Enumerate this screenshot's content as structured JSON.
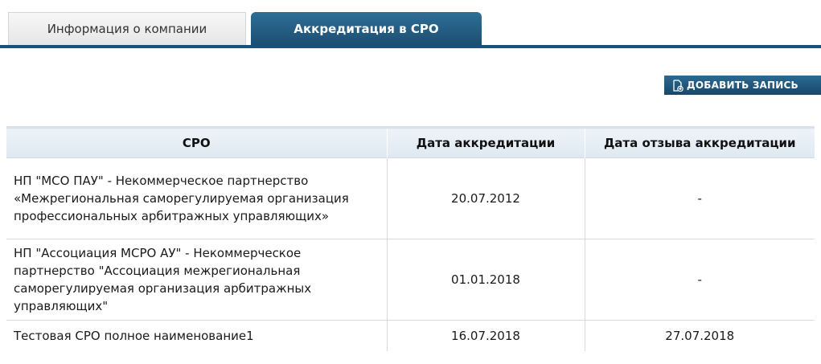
{
  "tabs": [
    {
      "label": "Информация о компании",
      "active": false
    },
    {
      "label": "Аккредитация в СРО",
      "active": true
    }
  ],
  "toolbar": {
    "add_label": "ДОБАВИТЬ ЗАПИСЬ",
    "add_icon": "add-document-icon"
  },
  "table": {
    "columns": [
      "СРО",
      "Дата аккредитации",
      "Дата отзыва аккредитации"
    ],
    "rows": [
      {
        "sro": "НП \"МСО ПАУ\" - Некоммерческое партнерство «Межрегиональная саморегулируемая организация профессиональных арбитражных управляющих»",
        "accreditation_date": "20.07.2012",
        "revocation_date": "-"
      },
      {
        "sro": "НП \"Ассоциация МСРО АУ\" - Некоммерческое партнерство \"Ассоциация межрегиональная саморегулируемая организация арбитражных управляющих\"",
        "accreditation_date": "01.01.2018",
        "revocation_date": "-"
      },
      {
        "sro": "Тестовая СРО полное наименование1",
        "accreditation_date": "16.07.2018",
        "revocation_date": "27.07.2018"
      }
    ]
  },
  "colors": {
    "accent": "#1d5276",
    "header_bg": "#e4ecf4"
  }
}
